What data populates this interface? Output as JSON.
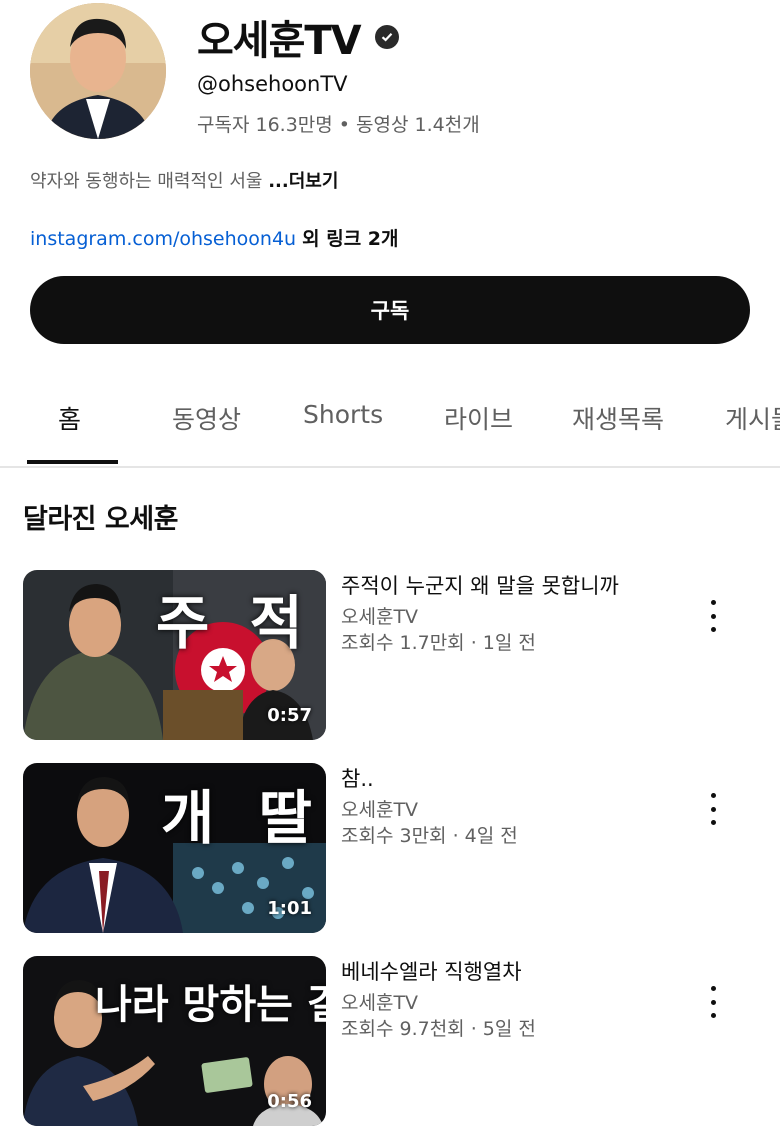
{
  "channel": {
    "name": "오세훈TV",
    "handle": "@ohsehoonTV",
    "stats": "구독자 16.3만명 • 동영상 1.4천개",
    "description": "약자와 동행하는 매력적인 서울",
    "more_label": "...더보기",
    "link_url": "instagram.com/ohsehoon4u",
    "link_extra": "외 링크 2개",
    "subscribe_label": "구독"
  },
  "tabs": [
    {
      "label": "홈",
      "active": true
    },
    {
      "label": "동영상"
    },
    {
      "label": "Shorts"
    },
    {
      "label": "라이브"
    },
    {
      "label": "재생목록"
    },
    {
      "label": "게시물"
    }
  ],
  "section": {
    "title": "달라진 오세훈"
  },
  "videos": [
    {
      "title": "주적이 누군지 왜 말을 못합니까",
      "channel": "오세훈TV",
      "meta": "조회수 1.7만회 · 1일 전",
      "duration": "0:57",
      "thumb_text": "주 적"
    },
    {
      "title": "참..",
      "channel": "오세훈TV",
      "meta": "조회수 3만회 · 4일 전",
      "duration": "1:01",
      "thumb_text": "개 딸"
    },
    {
      "title": "베네수엘라 직행열차",
      "channel": "오세훈TV",
      "meta": "조회수 9.7천회 · 5일 전",
      "duration": "0:56",
      "thumb_text": "나라 망하는 길"
    }
  ],
  "colors": {
    "link": "#065fd4",
    "primary": "#0f0f0f",
    "secondary": "#606060"
  }
}
